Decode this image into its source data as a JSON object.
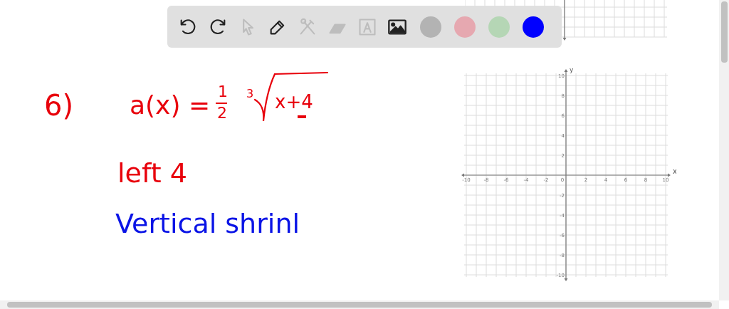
{
  "toolbar": {
    "tools": [
      {
        "kind": "undo",
        "disabled": false
      },
      {
        "kind": "redo",
        "disabled": false
      },
      {
        "kind": "select",
        "disabled": true
      },
      {
        "kind": "pen",
        "disabled": false
      },
      {
        "kind": "tools",
        "disabled": true
      },
      {
        "kind": "eraser",
        "disabled": true
      },
      {
        "kind": "text",
        "disabled": true
      },
      {
        "kind": "image",
        "disabled": false
      }
    ],
    "colors": [
      {
        "color": "#b3b3b3"
      },
      {
        "color": "#e6a8b0"
      },
      {
        "color": "#b5d6b5"
      },
      {
        "color": "#0000ff"
      }
    ]
  },
  "work": {
    "problem_number": "6)",
    "lhs": "a(x) =",
    "numerator": "1",
    "denominator": "2",
    "root_index": "3",
    "radicand": "x+4",
    "color": "#e8000b",
    "notes": [
      {
        "text": "left 4",
        "color": "#e8000b"
      },
      {
        "text": "Vertical shrinl",
        "color": "#0a14e6"
      }
    ]
  },
  "graph": {
    "x_label": "x",
    "y_label": "y",
    "xticks": [
      "-10",
      "-8",
      "-6",
      "-4",
      "-2",
      "0",
      "2",
      "4",
      "6",
      "8",
      "10"
    ],
    "yticks": [
      "10",
      "8",
      "6",
      "4",
      "2",
      "-2",
      "-4",
      "-6",
      "-8",
      "-10"
    ]
  }
}
